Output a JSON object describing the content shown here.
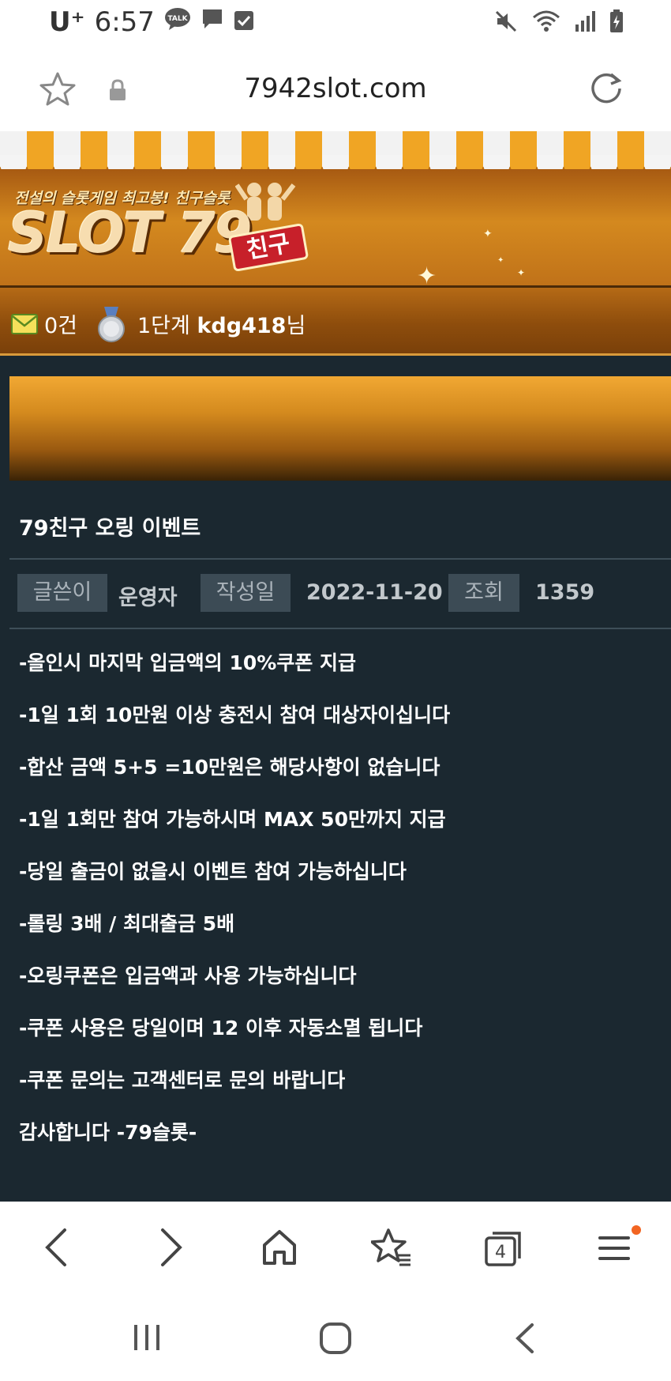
{
  "status_bar": {
    "carrier": "U⁺",
    "time": "6:57",
    "talk_badge": "TALK"
  },
  "url_bar": {
    "url": "7942slot.com"
  },
  "site_banner": {
    "tagline": "전설의 슬롯게임 최고봉! 친구슬롯",
    "logo": "SLOT 79",
    "logo_badge": "친구"
  },
  "user_bar": {
    "message_count": "0건",
    "level": "1단계",
    "username": "kdg418",
    "honorific": "님"
  },
  "post": {
    "title": "79친구 오링 이벤트",
    "meta": {
      "author_label": "글쓴이",
      "author": "운영자",
      "date_label": "작성일",
      "date": "2022-11-20",
      "views_label": "조회",
      "views": "1359"
    },
    "lines": [
      "-올인시 마지막 입금액의 10%쿠폰 지급",
      "-1일 1회 10만원 이상 충전시 참여 대상자이십니다",
      "-합산 금액 5+5 =10만원은 해당사항이 없습니다",
      "-1일 1회만 참여 가능하시며 MAX 50만까지 지급",
      "-당일 출금이 없을시 이벤트 참여 가능하십니다",
      "-롤링 3배 / 최대출금 5배",
      "-오링쿠폰은 입금액과 사용 가능하십니다",
      "-쿠폰 사용은 당일이며 12 이후 자동소멸 됩니다",
      "-쿠폰 문의는 고객센터로 문의 바랍니다",
      "감사합니다 -79슬롯-"
    ]
  },
  "browser_nav": {
    "tab_count": "4"
  },
  "colors": {
    "page_bg": "#1b2830",
    "accent_orange": "#f0a524",
    "notification_dot": "#f26522"
  }
}
